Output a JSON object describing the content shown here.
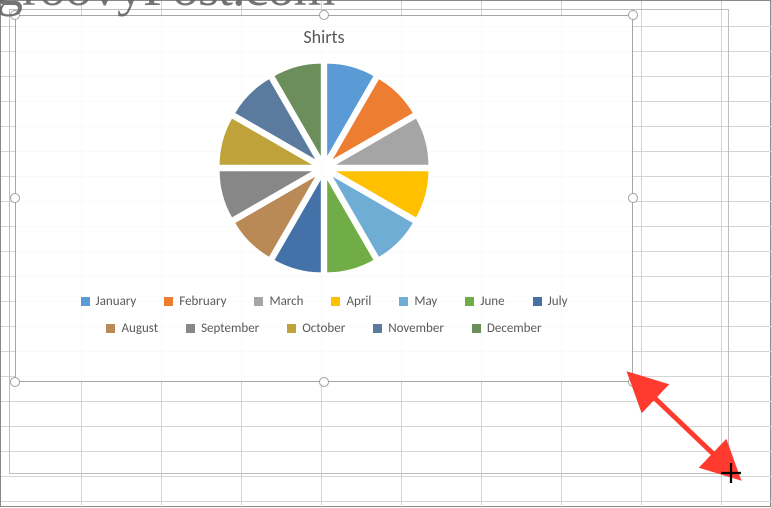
{
  "watermark": "groovyPost.com",
  "chart_data": {
    "type": "pie",
    "title": "Shirts",
    "categories": [
      "January",
      "February",
      "March",
      "April",
      "May",
      "June",
      "July",
      "August",
      "September",
      "October",
      "November",
      "December"
    ],
    "values": [
      1,
      1,
      1,
      1,
      1,
      1,
      1,
      1,
      1,
      1,
      1,
      1
    ],
    "series": [
      {
        "name": "Shirts",
        "values": [
          1,
          1,
          1,
          1,
          1,
          1,
          1,
          1,
          1,
          1,
          1,
          1
        ]
      }
    ],
    "colors": [
      "#5b9bd5",
      "#ed7d31",
      "#a5a5a5",
      "#ffc000",
      "#70add4",
      "#70ad47",
      "#4472a8",
      "#b98a56",
      "#878787",
      "#bfa33a",
      "#5a7a9e",
      "#6b8e5a"
    ],
    "xlabel": "",
    "ylabel": "",
    "exploded": true,
    "legend_position": "bottom"
  },
  "legend": {
    "items": [
      {
        "label": "January"
      },
      {
        "label": "February"
      },
      {
        "label": "March"
      },
      {
        "label": "April"
      },
      {
        "label": "May"
      },
      {
        "label": "June"
      },
      {
        "label": "July"
      },
      {
        "label": "August"
      },
      {
        "label": "September"
      },
      {
        "label": "October"
      },
      {
        "label": "November"
      },
      {
        "label": "December"
      }
    ]
  }
}
